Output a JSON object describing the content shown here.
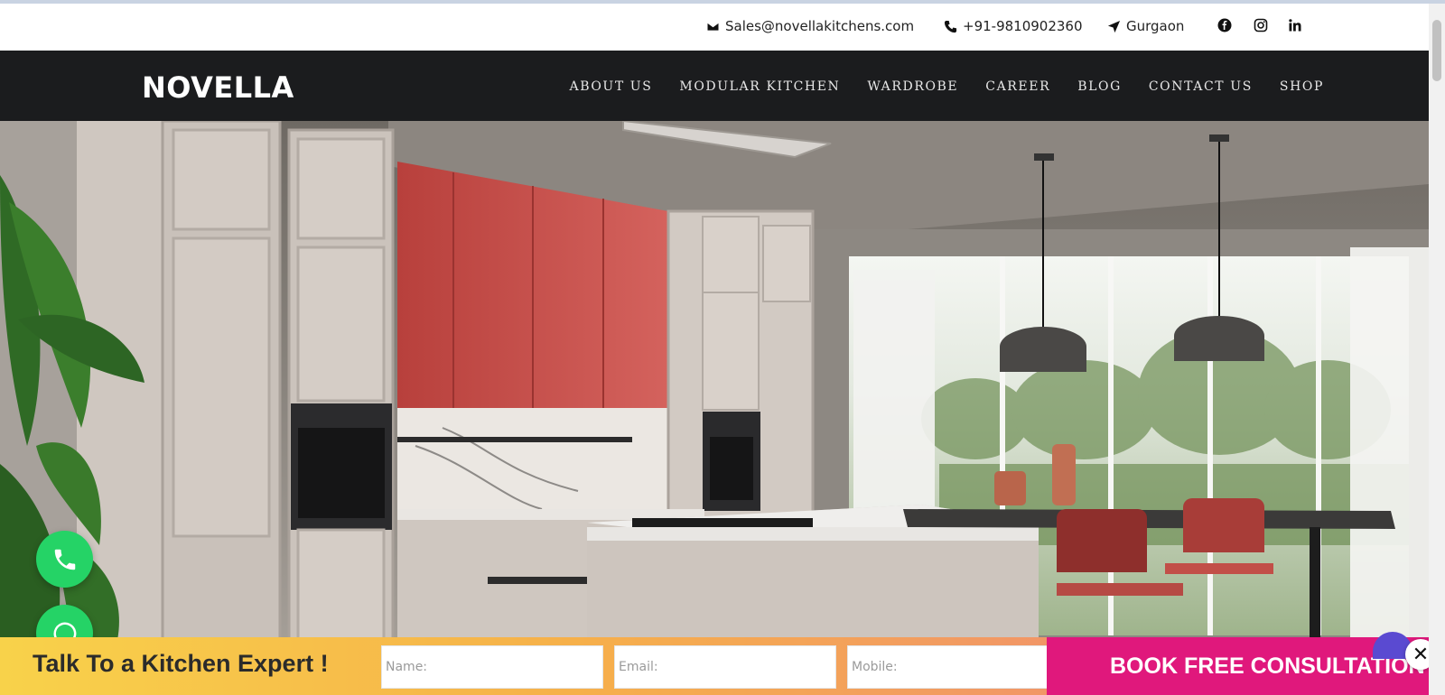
{
  "contact": {
    "email": "Sales@novellakitchens.com",
    "phone": "+91-9810902360",
    "location": "Gurgaon"
  },
  "social_icons": [
    "facebook-icon",
    "instagram-icon",
    "linkedin-icon"
  ],
  "brand": {
    "logo_text": "NOVELLA"
  },
  "nav": {
    "items": [
      "ABOUT US",
      "MODULAR KITCHEN",
      "WARDROBE",
      "CAREER",
      "BLOG",
      "CONTACT US",
      "SHOP"
    ]
  },
  "cta": {
    "title": "Talk To a Kitchen Expert !",
    "name_placeholder": "Name:",
    "email_placeholder": "Email:",
    "mobile_placeholder": "Mobile:",
    "button_label": "BOOK FREE CONSULTATION",
    "close_label": "✕"
  },
  "colors": {
    "nav_bg": "#1b1c1e",
    "cta_button": "#e0187c",
    "fab_green": "#25d366",
    "accent_red_cabinet": "#c9524f"
  }
}
